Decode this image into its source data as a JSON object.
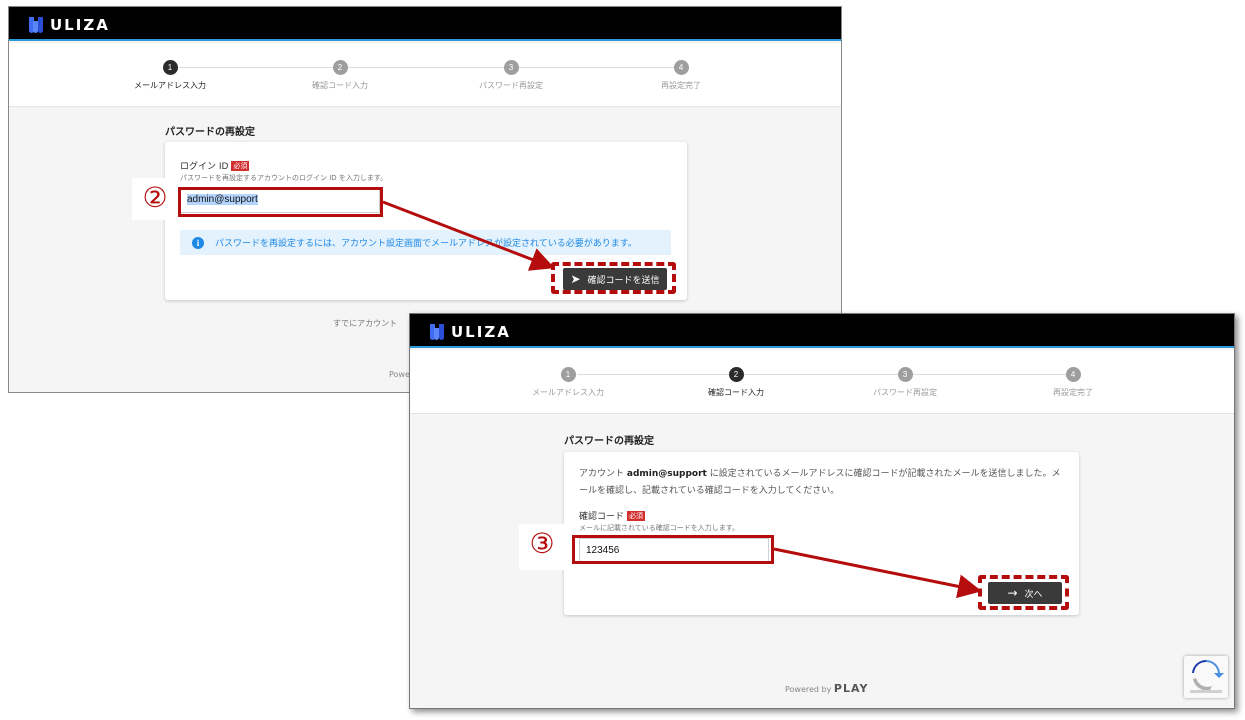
{
  "app": {
    "logo_text": "ULIZA"
  },
  "steps": [
    {
      "number": "1",
      "label": "メールアドレス入力"
    },
    {
      "number": "2",
      "label": "確認コード入力"
    },
    {
      "number": "3",
      "label": "パスワード再設定"
    },
    {
      "number": "4",
      "label": "再設定完了"
    }
  ],
  "screen1": {
    "page_title": "パスワードの再設定",
    "field_label": "ログイン ID",
    "required_badge": "必須",
    "field_hint": "パスワードを再設定するアカウントのログイン ID を入力します。",
    "field_value": "admin@support",
    "info_message": "パスワードを再設定するには、アカウント設定画面でメールアドレスが設定されている必要があります。",
    "submit_label": "確認コードを送信",
    "footer_link": "すでにアカウント",
    "powered_partial": "Powe"
  },
  "screen2": {
    "page_title": "パスワードの再設定",
    "message_pre": "アカウント",
    "message_account": "admin@support",
    "message_post": "に設定されているメールアドレスに確認コードが記載されたメールを送信しました。メールを確認し、記載されている確認コードを入力してください。",
    "field_label": "確認コード",
    "required_badge": "必須",
    "field_hint": "メールに記載されている確認コードを入力します。",
    "field_value": "123456",
    "next_label": "次へ",
    "powered_by": "Powered by",
    "powered_brand": "PLAY"
  },
  "annotations": {
    "step2": "②",
    "step3": "③"
  },
  "colors": {
    "accent_red": "#b50d0d",
    "info_blue": "#1e88e5",
    "required_red": "#d32f2f"
  }
}
